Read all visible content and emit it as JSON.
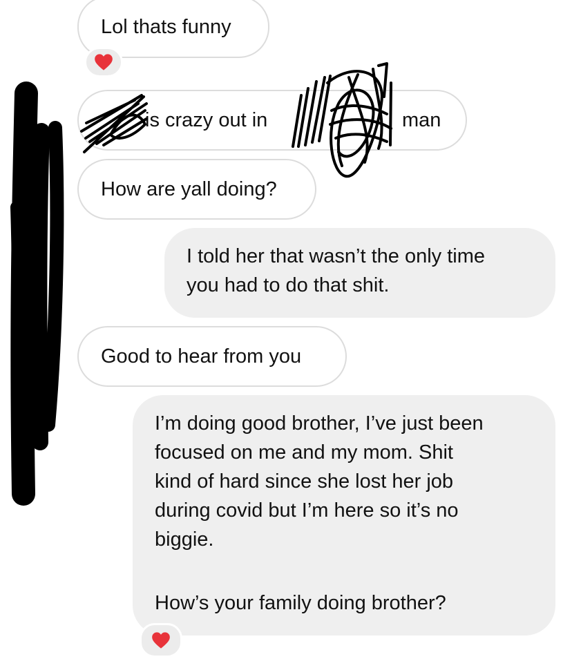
{
  "thread": {
    "messages": [
      {
        "direction": "incoming",
        "text": "Lol thats funny",
        "reaction": "heart-icon"
      },
      {
        "direction": "incoming",
        "text_visible_before": "is crazy out in",
        "text_visible_after": "man",
        "redacted": true
      },
      {
        "direction": "incoming",
        "text": "How are yall doing?"
      },
      {
        "direction": "outgoing",
        "lines": [
          "I told her that wasn’t the only time",
          "you had to do that shit."
        ]
      },
      {
        "direction": "incoming",
        "text": "Good to hear from you"
      },
      {
        "direction": "outgoing",
        "lines": [
          "I’m doing good brother, I’ve just been",
          "focused on me and my mom. Shit",
          "kind of hard since she lost her job",
          "during covid but I’m here so it’s no",
          "biggie."
        ],
        "second_paragraph": "How’s your family doing brother?",
        "reaction": "heart-icon"
      }
    ]
  },
  "colors": {
    "incoming_border": "#dcdcdc",
    "outgoing_bg": "#efefef",
    "reaction_bg": "#ececec",
    "heart": "#e8333a",
    "redaction": "#000000"
  }
}
